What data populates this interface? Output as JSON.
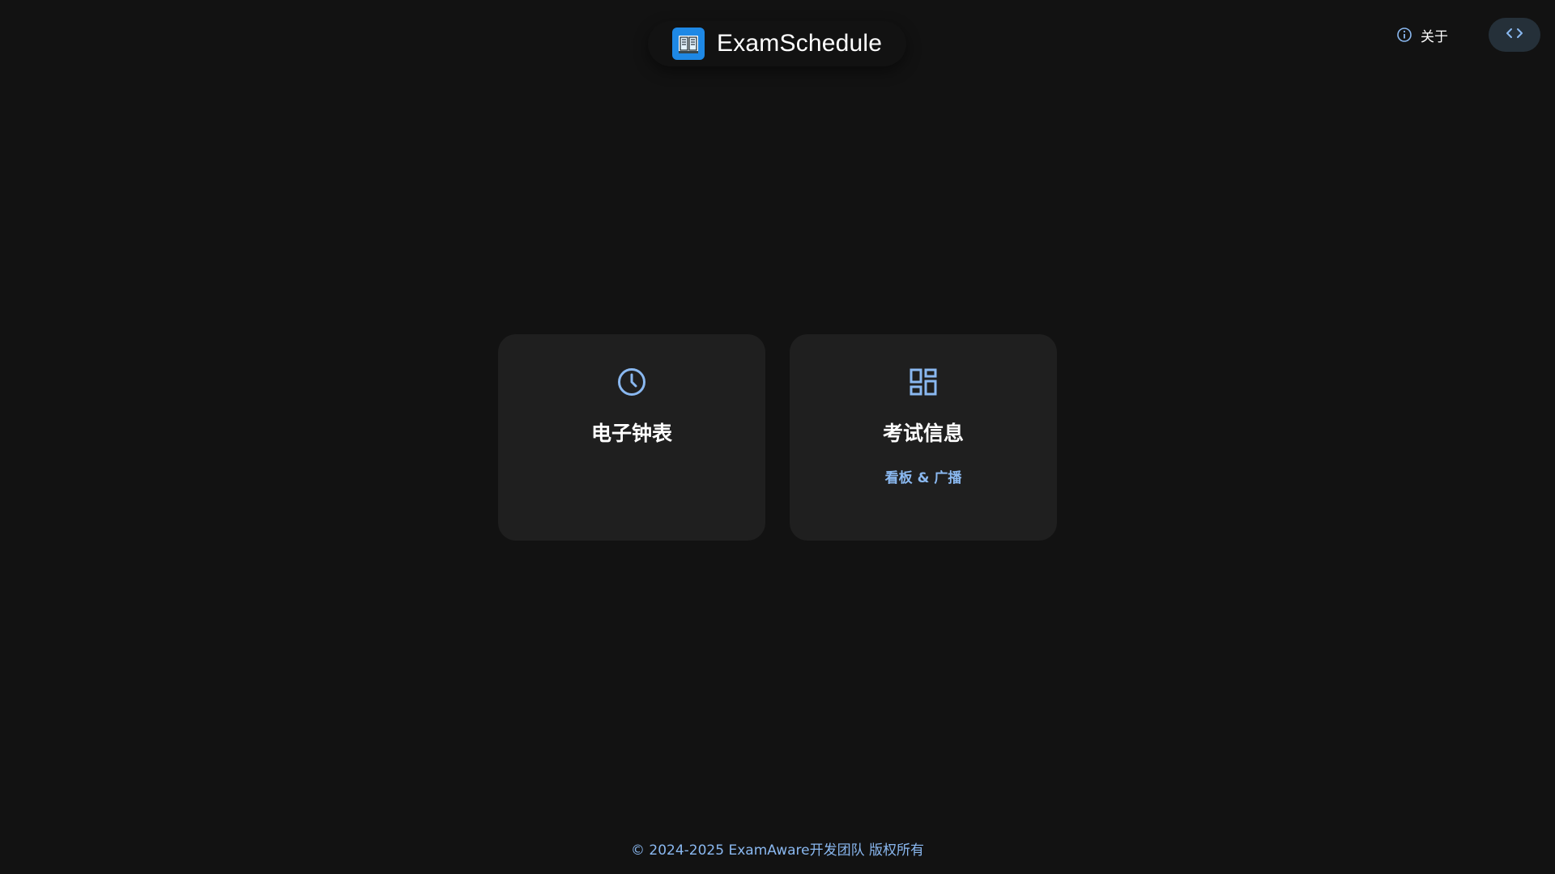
{
  "header": {
    "title": "ExamSchedule",
    "logo_icon": "open-book-icon"
  },
  "top_actions": {
    "about_label": "关于",
    "about_icon": "info-icon",
    "code_icon": "code-icon"
  },
  "cards": [
    {
      "title": "电子钟表",
      "subtitle": "",
      "icon": "clock-icon"
    },
    {
      "title": "考试信息",
      "subtitle": "看板 & 广播",
      "icon": "dashboard-icon"
    }
  ],
  "footer": {
    "text": "© 2024-2025 ExamAware开发团队 版权所有"
  },
  "colors": {
    "background": "#121212",
    "card": "#1f1f1f",
    "accent": "#8ab8f0",
    "logo": "#1e88e5",
    "code_button": "#253039"
  }
}
